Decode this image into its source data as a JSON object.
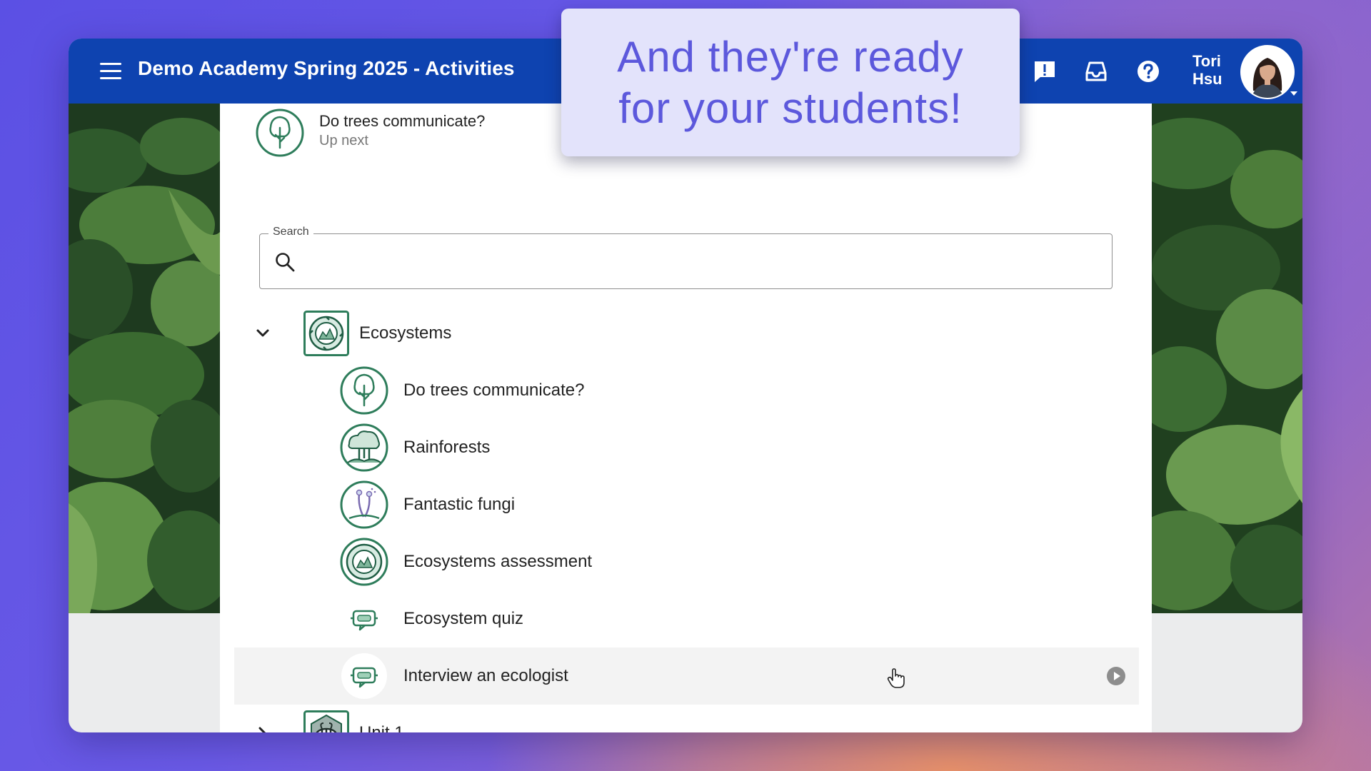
{
  "header": {
    "title": "Demo Academy Spring 2025 - Activities",
    "user_first": "Tori",
    "user_last": "Hsu"
  },
  "up_next": {
    "title": "Do trees communicate?",
    "subtitle": "Up next"
  },
  "search": {
    "label": "Search",
    "value": "",
    "placeholder": ""
  },
  "units": [
    {
      "label": "Ecosystems",
      "expanded": true,
      "activities": [
        {
          "label": "Do trees communicate?",
          "icon": "tree-icon"
        },
        {
          "label": "Rainforests",
          "icon": "rainforest-icon"
        },
        {
          "label": "Fantastic fungi",
          "icon": "fungi-icon"
        },
        {
          "label": "Ecosystems assessment",
          "icon": "ecosystem-icon"
        },
        {
          "label": "Ecosystem quiz",
          "icon": "chat-bot-icon"
        },
        {
          "label": "Interview an ecologist",
          "icon": "chat-bot-icon",
          "highlighted": true
        }
      ]
    },
    {
      "label": "Unit 1",
      "expanded": false
    }
  ],
  "callout": {
    "line1": "And they're ready",
    "line2": "for your students!"
  },
  "colors": {
    "topbar": "#0e43b0",
    "icon_green": "#2e7d5b",
    "callout_bg": "#e3e3fb",
    "callout_text": "#5c58dc"
  }
}
